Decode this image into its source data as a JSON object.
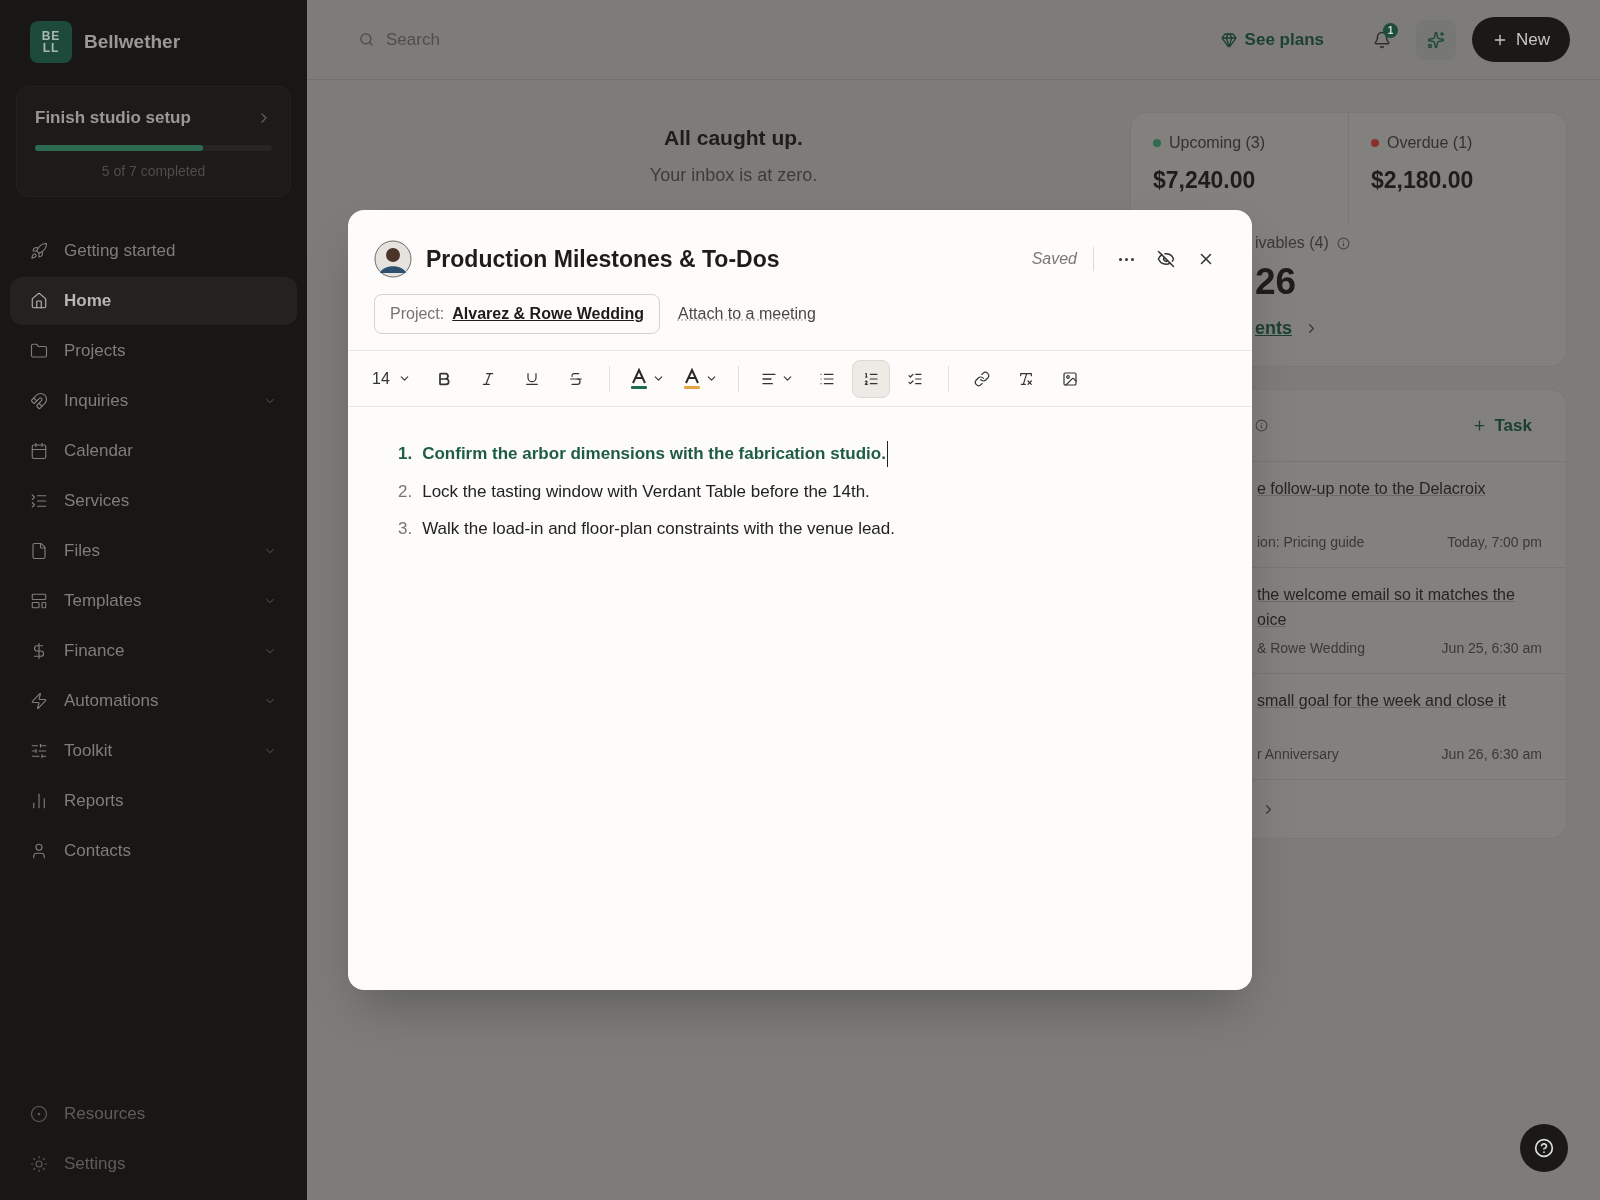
{
  "sidebar": {
    "logo": "BELL",
    "brand": "Bellwether",
    "setup": {
      "title": "Finish studio setup",
      "level": 0.71,
      "caption": "5 of 7 completed"
    },
    "items": [
      {
        "label": "Getting started",
        "selected": false,
        "has_submenu": false
      },
      {
        "label": "Home",
        "selected": true,
        "has_submenu": false
      },
      {
        "label": "Projects",
        "selected": false,
        "has_submenu": false
      },
      {
        "label": "Inquiries",
        "selected": false,
        "has_submenu": true
      },
      {
        "label": "Calendar",
        "selected": false,
        "has_submenu": false
      },
      {
        "label": "Services",
        "selected": false,
        "has_submenu": false
      },
      {
        "label": "Files",
        "selected": false,
        "has_submenu": true
      },
      {
        "label": "Templates",
        "selected": false,
        "has_submenu": true
      },
      {
        "label": "Finance",
        "selected": false,
        "has_submenu": true
      },
      {
        "label": "Automations",
        "selected": false,
        "has_submenu": true
      },
      {
        "label": "Toolkit",
        "selected": false,
        "has_submenu": true
      },
      {
        "label": "Reports",
        "selected": false,
        "has_submenu": false
      },
      {
        "label": "Contacts",
        "selected": false,
        "has_submenu": false
      }
    ],
    "footer_items": [
      {
        "label": "Resources"
      },
      {
        "label": "Settings"
      }
    ]
  },
  "topbar": {
    "search": {
      "placeholder": "Search"
    },
    "plans": "See plans",
    "notifications": "1",
    "new_button": "New"
  },
  "inbox": {
    "title": "All caught up.",
    "subtitle": "Your inbox is at zero."
  },
  "payments_card": {
    "stats": [
      {
        "label": "Upcoming (3)",
        "color": "#2f6b4f",
        "amount": "$7,240.00"
      },
      {
        "label": "Overdue (1)",
        "color": "#8a2f2a",
        "amount": "$2,180.00"
      }
    ],
    "receivables_label": "ivables (4)",
    "receivables_amount": "26",
    "link": "ents"
  },
  "tasks_card": {
    "add": "Task",
    "rows": [
      {
        "title": "e follow-up note to the Delacroix",
        "meta": "ion: Pricing guide",
        "due": "Today, 7:00 pm"
      },
      {
        "title": "the welcome email so it matches the",
        "title_2": "oice",
        "meta": "& Rowe Wedding",
        "due": "Jun 25, 6:30 am"
      },
      {
        "title": "small goal for the week and close it",
        "meta": "r Anniversary",
        "due": "Jun 26, 6:30 am"
      }
    ]
  },
  "note": {
    "title": "Production Milestones & To-Dos",
    "status": "Saved",
    "project_label": "Project:",
    "project": "Alvarez & Rowe Wedding",
    "attach": "Attach to a meeting",
    "toolbar": {
      "font_size": "14",
      "tools": [
        {
          "kind": "bold",
          "selected": false
        },
        {
          "kind": "italic",
          "selected": false
        },
        {
          "kind": "underline",
          "selected": false
        },
        {
          "kind": "strike",
          "selected": false
        },
        {
          "kind": "divider"
        },
        {
          "kind": "text-color",
          "color": "#1f6b4f"
        },
        {
          "kind": "highlight",
          "color": "#e2a542"
        },
        {
          "kind": "divider"
        },
        {
          "kind": "align",
          "selected": false
        },
        {
          "kind": "bullets",
          "selected": false
        },
        {
          "kind": "numbers",
          "selected": true
        },
        {
          "kind": "checklist",
          "selected": false
        },
        {
          "kind": "divider"
        },
        {
          "kind": "link",
          "selected": false
        },
        {
          "kind": "clear",
          "selected": false
        },
        {
          "kind": "image",
          "selected": false
        }
      ]
    },
    "lines": [
      {
        "number": "1.",
        "text": "Confirm the arbor dimensions with the fabrication studio.",
        "active": true
      },
      {
        "number": "2.",
        "text": "Lock the tasting window with Verdant Table before the 14th.",
        "active": false
      },
      {
        "number": "3.",
        "text": "Walk the load-in and floor-plan constraints with the venue lead.",
        "active": false
      }
    ]
  }
}
